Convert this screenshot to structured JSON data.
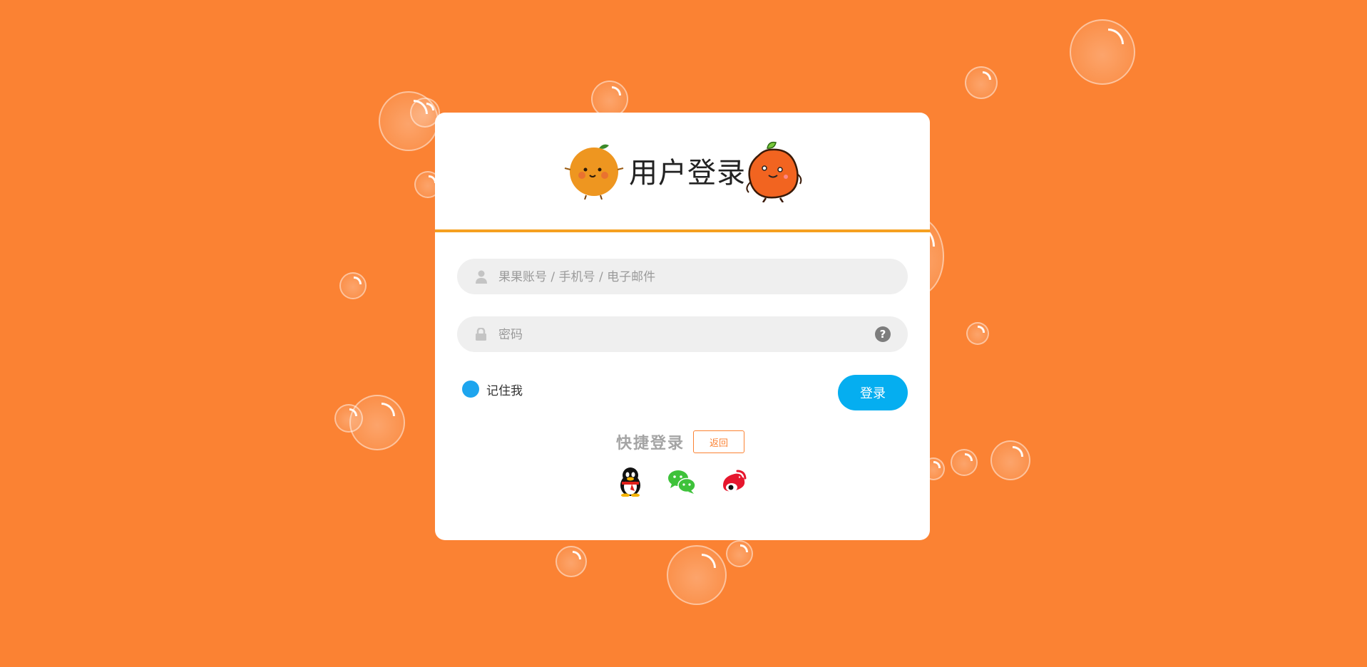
{
  "theme": {
    "background": "#fb8233",
    "accent": "#f5a020",
    "primary": "#05aef0"
  },
  "login": {
    "title": "用户登录",
    "username_placeholder": "果果账号 / 手机号 / 电子邮件",
    "password_placeholder": "密码",
    "remember_label": "记住我",
    "submit_label": "登录",
    "quick_login_label": "快捷登录",
    "back_label": "返回",
    "social_icons": [
      "qq-icon",
      "wechat-icon",
      "weibo-icon"
    ]
  }
}
